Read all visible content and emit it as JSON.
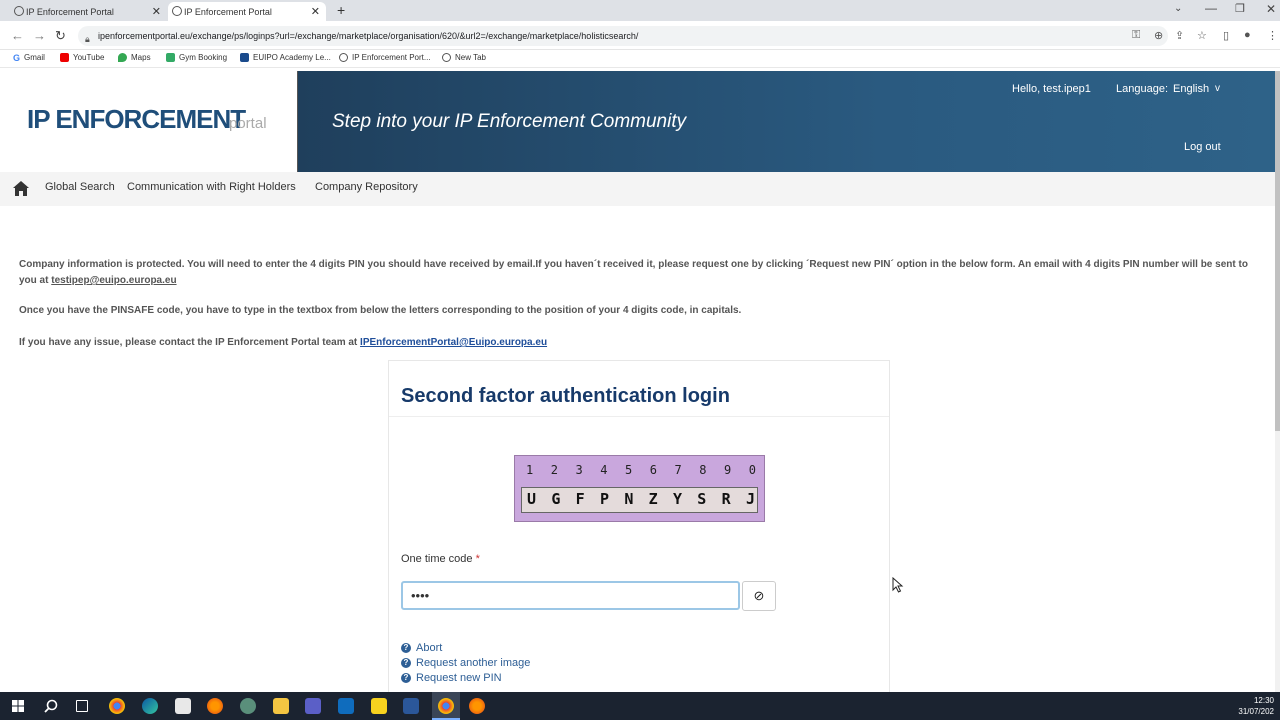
{
  "browser": {
    "tabs": [
      {
        "title": "IP Enforcement Portal",
        "active": false
      },
      {
        "title": "IP Enforcement Portal",
        "active": true
      }
    ],
    "url": "ipenforcementportal.eu/exchange/ps/loginps?url=/exchange/marketplace/organisation/620/&url2=/exchange/marketplace/holisticsearch/",
    "bookmarks": [
      "Gmail",
      "YouTube",
      "Maps",
      "Gym Booking",
      "EUIPO Academy Le...",
      "IP Enforcement Port...",
      "New Tab"
    ]
  },
  "header": {
    "logo_main": "IP ENFORCEMENT",
    "logo_sub": "portal",
    "tagline": "Step into your IP Enforcement Community",
    "greeting": "Hello, test.ipep1",
    "language_label": "Language:",
    "language_value": "English",
    "language_caret": "v",
    "logout": "Log out"
  },
  "nav": {
    "items": [
      "Global Search",
      "Communication with Right Holders",
      "Company Repository"
    ]
  },
  "info": {
    "p1_text": "Company information is protected. You will need to enter the 4 digits PIN you should have received by email.If you haven´t received it, please request one by clicking ´Request new PIN´ option in the below form. An email with 4 digits PIN number will be sent to you at ",
    "p1_email": "testipep@euipo.europa.eu",
    "p2_text": "Once you have the PINSAFE code, you have to type in the textbox from below the letters corresponding to the position of your 4 digits code, in capitals.",
    "p3_text": "If you have any issue, please contact the IP Enforcement Portal team at ",
    "p3_email": "IPEnforcementPortal@Euipo.europa.eu"
  },
  "login": {
    "title": "Second factor authentication login",
    "pinsafe_digits": [
      "1",
      "2",
      "3",
      "4",
      "5",
      "6",
      "7",
      "8",
      "9",
      "0"
    ],
    "pinsafe_letters": [
      "U",
      "G",
      "F",
      "P",
      "N",
      "Z",
      "Y",
      "S",
      "R",
      "J"
    ],
    "otc_label": "One time code",
    "otc_required": "*",
    "otc_value": "••••",
    "clear_icon": "⊘",
    "links": [
      "Abort",
      "Request another image",
      "Request new PIN"
    ]
  },
  "taskbar": {
    "time": "12:30",
    "date": "31/07/202"
  }
}
